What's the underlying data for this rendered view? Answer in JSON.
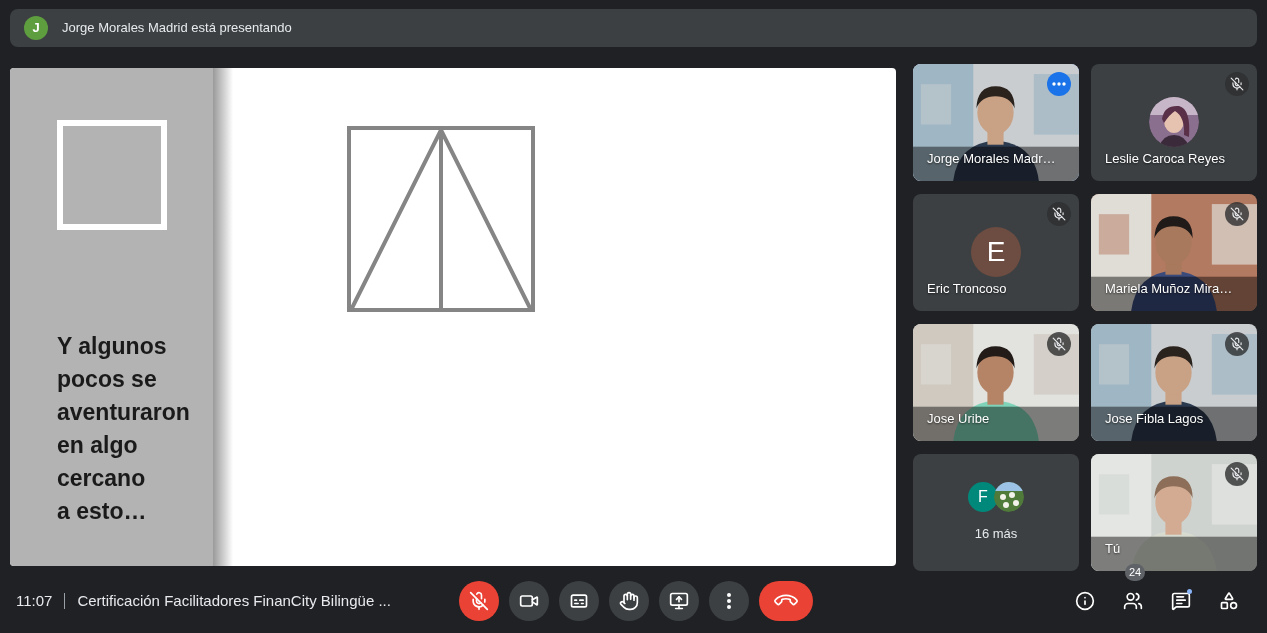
{
  "banner": {
    "avatar_letter": "J",
    "text": "Jorge Morales Madrid está presentando"
  },
  "slide": {
    "lines": [
      "Y algunos",
      "pocos se",
      "aventuraron",
      "en algo",
      "cercano",
      "a esto…"
    ]
  },
  "tiles": [
    {
      "kind": "video",
      "name": "Jorge Morales Madr…",
      "muted": false,
      "highlighted": true
    },
    {
      "kind": "photo_avatar",
      "name": "Leslie Caroca Reyes",
      "muted": true,
      "highlighted": false
    },
    {
      "kind": "letter_avatar",
      "letter": "E",
      "color": "#6d4c41",
      "name": "Eric Troncoso",
      "muted": true,
      "highlighted": false
    },
    {
      "kind": "video",
      "name": "Mariela Muñoz Mira…",
      "muted": true,
      "highlighted": false
    },
    {
      "kind": "video",
      "name": "Jose Uribe",
      "muted": true,
      "highlighted": false
    },
    {
      "kind": "video",
      "name": "Jose Fibla Lagos",
      "muted": true,
      "highlighted": false
    },
    {
      "kind": "more",
      "avatars": [
        {
          "kind": "letter",
          "letter": "F",
          "color": "#00897b"
        },
        {
          "kind": "picture"
        }
      ],
      "label": "16 más"
    },
    {
      "kind": "video",
      "name": "Tú",
      "muted": true,
      "highlighted": false
    }
  ],
  "footer": {
    "time": "11:07",
    "meeting_title": "Certificación Facilitadores FinanCity Bilingüe ...",
    "controls": [
      {
        "kind": "mic",
        "muted": true
      },
      {
        "kind": "camera"
      },
      {
        "kind": "captions"
      },
      {
        "kind": "hand"
      },
      {
        "kind": "present"
      },
      {
        "kind": "more"
      },
      {
        "kind": "hangup"
      }
    ],
    "side_buttons": [
      {
        "kind": "info"
      },
      {
        "kind": "people",
        "badge": "24"
      },
      {
        "kind": "chat",
        "unread": true
      },
      {
        "kind": "activities"
      }
    ]
  }
}
